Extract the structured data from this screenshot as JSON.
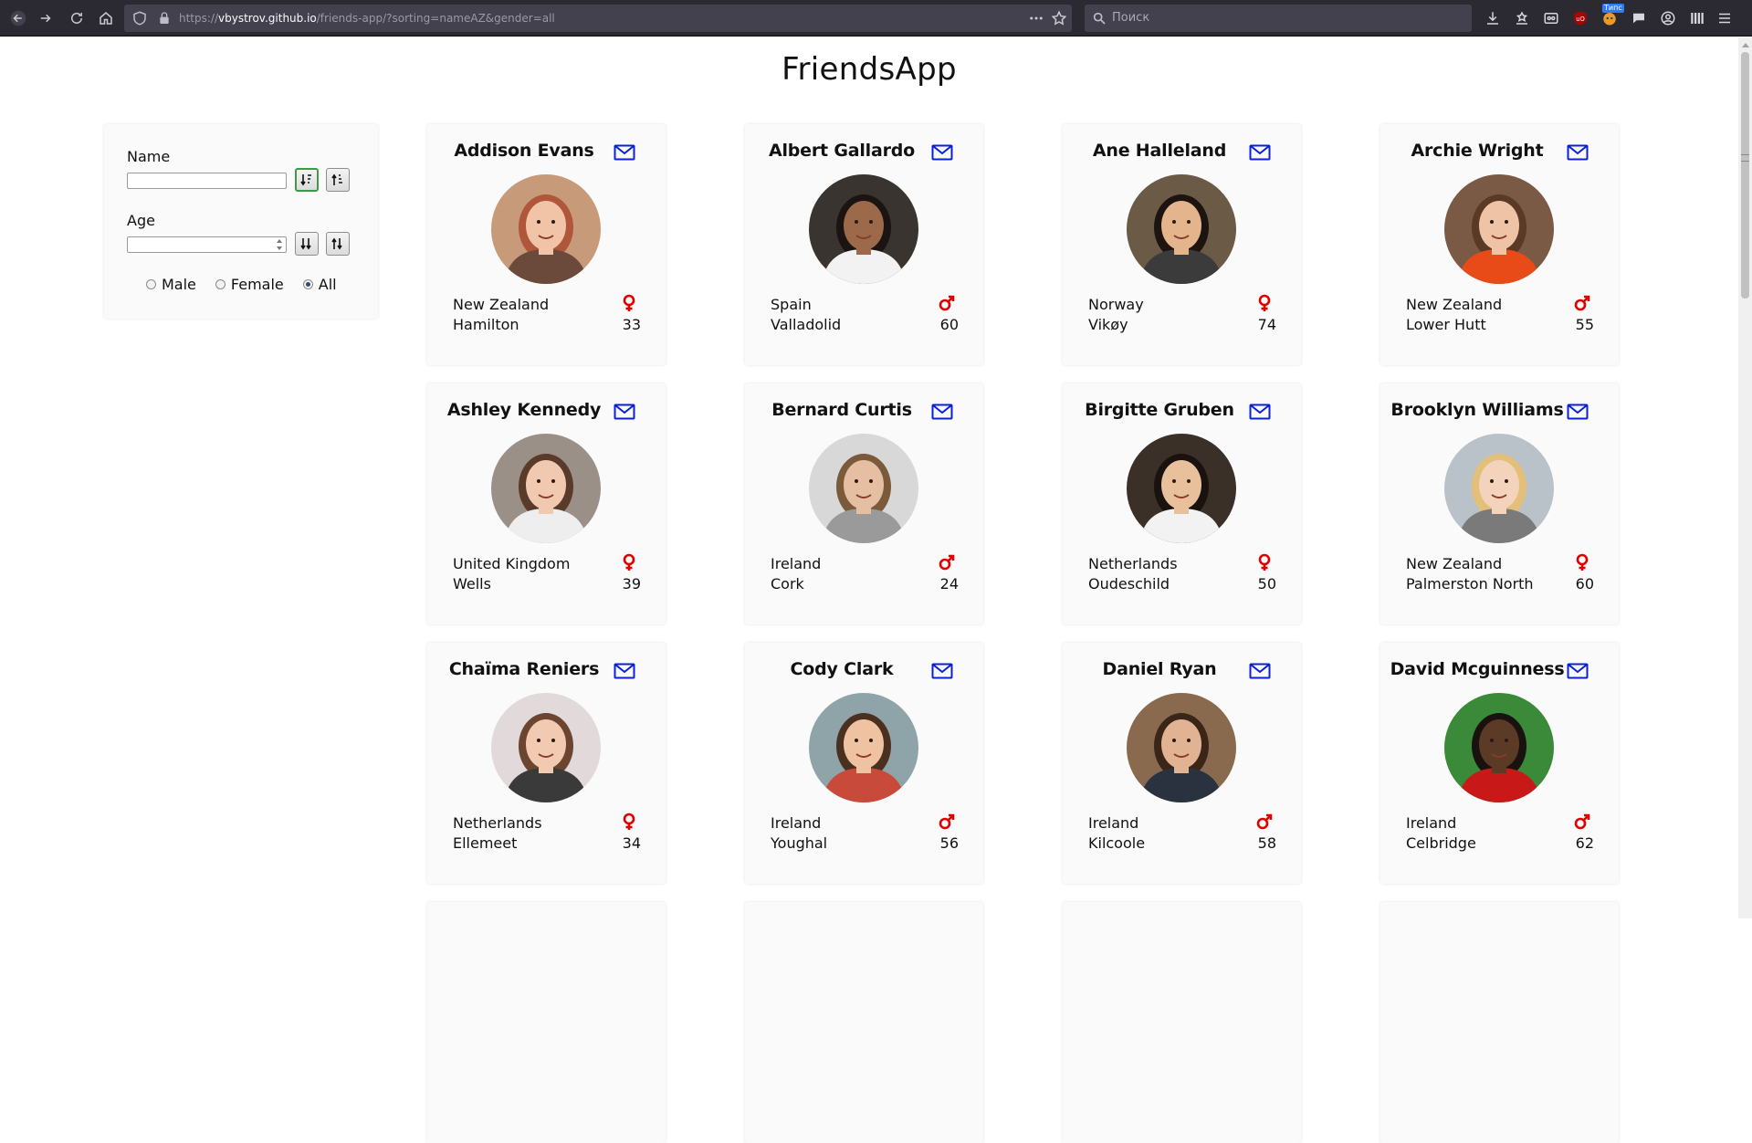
{
  "browser": {
    "url_prefix": "https://",
    "url_host": "vbystrov.github.io",
    "url_path": "/friends-app/?sorting=nameAZ&gender=all",
    "search_placeholder": "Поиск",
    "extension_badge": "Типс"
  },
  "app": {
    "title": "FriendsApp"
  },
  "filters": {
    "name_label": "Name",
    "age_label": "Age",
    "radios": [
      {
        "label": "Male",
        "checked": false
      },
      {
        "label": "Female",
        "checked": false
      },
      {
        "label": "All",
        "checked": true
      }
    ]
  },
  "friends": [
    {
      "name": "Addison Evans",
      "country": "New Zealand",
      "city": "Hamilton",
      "age": "33",
      "gender": "female",
      "avatar": {
        "bg": "#c79b7a",
        "skin": "#f1c4a8",
        "hair": "#b0563b",
        "shirt": "#6b4a3b"
      }
    },
    {
      "name": "Albert Gallardo",
      "country": "Spain",
      "city": "Valladolid",
      "age": "60",
      "gender": "male",
      "avatar": {
        "bg": "#3a3430",
        "skin": "#9c6a4a",
        "hair": "#1b1412",
        "shirt": "#f2f2f2"
      }
    },
    {
      "name": "Ane Halleland",
      "country": "Norway",
      "city": "Vikøy",
      "age": "74",
      "gender": "female",
      "avatar": {
        "bg": "#6b5a45",
        "skin": "#e4b58c",
        "hair": "#1d1410",
        "shirt": "#3b3b3b"
      }
    },
    {
      "name": "Archie Wright",
      "country": "New Zealand",
      "city": "Lower Hutt",
      "age": "55",
      "gender": "male",
      "avatar": {
        "bg": "#7a5a44",
        "skin": "#efc3a6",
        "hair": "#5a3a25",
        "shirt": "#e84a18"
      }
    },
    {
      "name": "Ashley Kennedy",
      "country": "United Kingdom",
      "city": "Wells",
      "age": "39",
      "gender": "female",
      "avatar": {
        "bg": "#9a9088",
        "skin": "#f0c9b0",
        "hair": "#5a3a28",
        "shirt": "#eeeeee"
      }
    },
    {
      "name": "Bernard Curtis",
      "country": "Ireland",
      "city": "Cork",
      "age": "24",
      "gender": "male",
      "avatar": {
        "bg": "#d8d8d8",
        "skin": "#e6bfa2",
        "hair": "#7a5a3a",
        "shirt": "#9a9a9a"
      }
    },
    {
      "name": "Birgitte Gruben",
      "country": "Netherlands",
      "city": "Oudeschild",
      "age": "50",
      "gender": "female",
      "avatar": {
        "bg": "#3b3028",
        "skin": "#e9c09c",
        "hair": "#1a120e",
        "shirt": "#f2f2f2"
      }
    },
    {
      "name": "Brooklyn Williams",
      "country": "New Zealand",
      "city": "Palmerston North",
      "age": "60",
      "gender": "female",
      "avatar": {
        "bg": "#b9c2c8",
        "skin": "#f3d3bb",
        "hair": "#e2c07a",
        "shirt": "#7a7a7a"
      }
    },
    {
      "name": "Chaïma Reniers",
      "country": "Netherlands",
      "city": "Ellemeet",
      "age": "34",
      "gender": "female",
      "avatar": {
        "bg": "#e2dada",
        "skin": "#f2c9b1",
        "hair": "#6b4530",
        "shirt": "#3a3a3a"
      }
    },
    {
      "name": "Cody Clark",
      "country": "Ireland",
      "city": "Youghal",
      "age": "56",
      "gender": "male",
      "avatar": {
        "bg": "#8ea4a8",
        "skin": "#efc2a2",
        "hair": "#4b3020",
        "shirt": "#c84a3a"
      }
    },
    {
      "name": "Daniel Ryan",
      "country": "Ireland",
      "city": "Kilcoole",
      "age": "58",
      "gender": "male",
      "avatar": {
        "bg": "#8a6a4e",
        "skin": "#e2b392",
        "hair": "#3a2618",
        "shirt": "#2a3240"
      }
    },
    {
      "name": "David Mcguinness",
      "country": "Ireland",
      "city": "Celbridge",
      "age": "62",
      "gender": "male",
      "avatar": {
        "bg": "#3a8a3a",
        "skin": "#5b3a26",
        "hair": "#1a1210",
        "shirt": "#c81818"
      }
    }
  ],
  "colors": {
    "mail": "#0a1fd8",
    "gender": "#e00000",
    "accent_active": "#3c9a4a"
  }
}
